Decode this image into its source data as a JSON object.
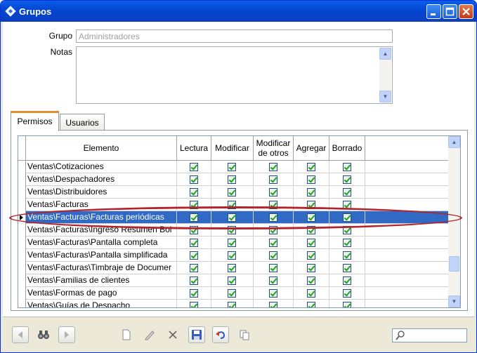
{
  "window": {
    "title": "Grupos"
  },
  "form": {
    "grupo_label": "Grupo",
    "grupo_value": "Administradores",
    "notas_label": "Notas",
    "notas_value": ""
  },
  "tabs": [
    {
      "label": "Permisos",
      "active": true
    },
    {
      "label": "Usuarios",
      "active": false
    }
  ],
  "grid": {
    "columns": [
      "Elemento",
      "Lectura",
      "Modificar",
      "Modificar de otros",
      "Agregar",
      "Borrado"
    ],
    "rows": [
      {
        "elemento": "Ventas\\Cotizaciones",
        "lectura": true,
        "modificar": true,
        "modificar_otros": true,
        "agregar": true,
        "borrado": true
      },
      {
        "elemento": "Ventas\\Despachadores",
        "lectura": true,
        "modificar": true,
        "modificar_otros": true,
        "agregar": true,
        "borrado": true
      },
      {
        "elemento": "Ventas\\Distribuidores",
        "lectura": true,
        "modificar": true,
        "modificar_otros": true,
        "agregar": true,
        "borrado": true
      },
      {
        "elemento": "Ventas\\Facturas",
        "lectura": true,
        "modificar": true,
        "modificar_otros": true,
        "agregar": true,
        "borrado": true
      },
      {
        "elemento": "Ventas\\Facturas\\Facturas periódicas",
        "lectura": true,
        "modificar": true,
        "modificar_otros": true,
        "agregar": true,
        "borrado": true,
        "selected": true
      },
      {
        "elemento": "Ventas\\Facturas\\Ingreso Resumen Bol",
        "lectura": true,
        "modificar": true,
        "modificar_otros": true,
        "agregar": true,
        "borrado": true
      },
      {
        "elemento": "Ventas\\Facturas\\Pantalla completa",
        "lectura": true,
        "modificar": true,
        "modificar_otros": true,
        "agregar": true,
        "borrado": true
      },
      {
        "elemento": "Ventas\\Facturas\\Pantalla simplificada",
        "lectura": true,
        "modificar": true,
        "modificar_otros": true,
        "agregar": true,
        "borrado": true
      },
      {
        "elemento": "Ventas\\Facturas\\Timbraje de Documer",
        "lectura": true,
        "modificar": true,
        "modificar_otros": true,
        "agregar": true,
        "borrado": true
      },
      {
        "elemento": "Ventas\\Familias de clientes",
        "lectura": true,
        "modificar": true,
        "modificar_otros": true,
        "agregar": true,
        "borrado": true
      },
      {
        "elemento": "Ventas\\Formas de pago",
        "lectura": true,
        "modificar": true,
        "modificar_otros": true,
        "agregar": true,
        "borrado": true
      },
      {
        "elemento": "Ventas\\Guías de Despacho",
        "lectura": true,
        "modificar": true,
        "modificar_otros": true,
        "agregar": true,
        "borrado": true
      }
    ]
  },
  "toolbar": {
    "icons": [
      "first-icon",
      "binoculars-icon",
      "next-icon",
      "new-icon",
      "edit-icon",
      "delete-icon",
      "save-icon",
      "undo-icon",
      "copy-icon",
      "search-icon"
    ]
  },
  "colors": {
    "selected_row": "#316ac5",
    "highlight_ellipse": "#b3242a",
    "title_bar": "#0a5de8"
  }
}
